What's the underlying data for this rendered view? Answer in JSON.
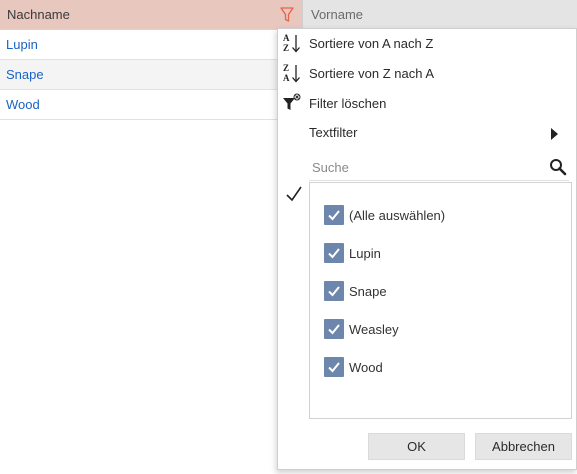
{
  "grid": {
    "columns": [
      {
        "label": "Nachname",
        "filter_icon": "funnel-icon",
        "filter_active_color": "#e8614a"
      },
      {
        "label": "Vorname"
      }
    ],
    "rows": [
      "Lupin",
      "Snape",
      "Wood"
    ]
  },
  "menu": {
    "sort_asc": {
      "icon": "sort-a-z-icon",
      "label": "Sortiere von A nach Z"
    },
    "sort_desc": {
      "icon": "sort-z-a-icon",
      "label": "Sortiere von Z nach A"
    },
    "clear_filter": {
      "icon": "clear-filter-icon",
      "label": "Filter löschen"
    },
    "text_filter": {
      "label": "Textfilter",
      "submenu_icon": "triangle-right-icon"
    },
    "search": {
      "placeholder": "Suche",
      "icon": "search-icon"
    },
    "list": [
      {
        "label": "(Alle auswählen)",
        "checked": true
      },
      {
        "label": "Lupin",
        "checked": true
      },
      {
        "label": "Snape",
        "checked": true
      },
      {
        "label": "Weasley",
        "checked": true
      },
      {
        "label": "Wood",
        "checked": true
      }
    ],
    "ok_label": "OK",
    "cancel_label": "Abbrechen"
  },
  "colors": {
    "header_active": "#e8c7bf",
    "header_inactive": "#e4e4e4",
    "link_text": "#1a63c6",
    "checkbox_fill": "#6d86ab"
  }
}
